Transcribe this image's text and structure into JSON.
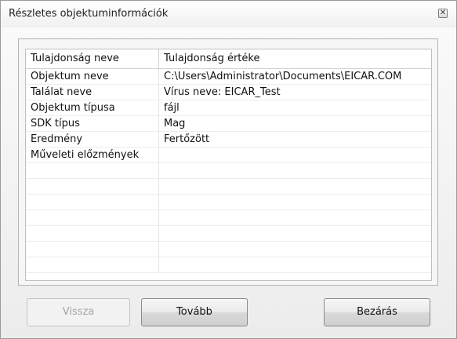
{
  "window": {
    "title": "Részletes objektuminformációk",
    "close_glyph": "✕"
  },
  "table": {
    "headers": [
      "Tulajdonság neve",
      "Tulajdonság értéke"
    ],
    "rows": [
      [
        "Objektum neve",
        "C:\\Users\\Administrator\\Documents\\EICAR.COM"
      ],
      [
        "Találat neve",
        "Vírus neve: EICAR_Test"
      ],
      [
        "Objektum típusa",
        "fájl"
      ],
      [
        "SDK típus",
        "Mag"
      ],
      [
        "Eredmény",
        "Fertőzött"
      ],
      [
        "Műveleti előzmények",
        ""
      ],
      [
        "",
        ""
      ],
      [
        "",
        ""
      ],
      [
        "",
        ""
      ],
      [
        "",
        ""
      ],
      [
        "",
        ""
      ],
      [
        "",
        ""
      ],
      [
        "",
        ""
      ]
    ]
  },
  "buttons": {
    "back": "Vissza",
    "next": "Tovább",
    "close": "Bezárás"
  }
}
